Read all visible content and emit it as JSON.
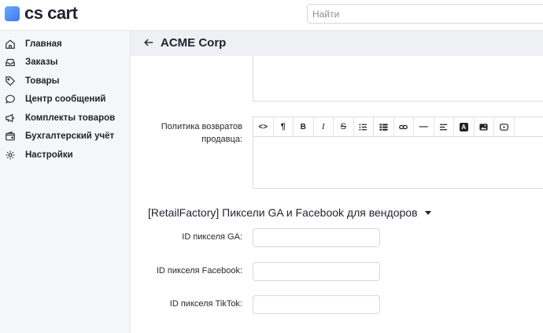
{
  "app": {
    "logo_text": "cs cart"
  },
  "search": {
    "placeholder": "Найти"
  },
  "sidebar": {
    "items": [
      {
        "label": "Главная",
        "icon": "home-icon"
      },
      {
        "label": "Заказы",
        "icon": "inbox-icon"
      },
      {
        "label": "Товары",
        "icon": "tag-icon"
      },
      {
        "label": "Центр сообщений",
        "icon": "message-icon"
      },
      {
        "label": "Комплекты товаров",
        "icon": "megaphone-icon"
      },
      {
        "label": "Бухгалтерский учёт",
        "icon": "wallet-icon"
      },
      {
        "label": "Настройки",
        "icon": "gear-icon"
      }
    ]
  },
  "header": {
    "title": "ACME Corp",
    "back_icon": "arrow-left-icon"
  },
  "form": {
    "return_policy_label": "Политика возвратов продавца:",
    "toolbar_buttons": [
      {
        "name": "code-view",
        "glyph": "<>"
      },
      {
        "name": "paragraph",
        "glyph": "¶"
      },
      {
        "name": "bold",
        "glyph": "B"
      },
      {
        "name": "italic",
        "glyph": "I"
      },
      {
        "name": "strikethrough",
        "glyph": "S"
      },
      {
        "name": "unordered-list",
        "glyph": ""
      },
      {
        "name": "ordered-list",
        "glyph": ""
      },
      {
        "name": "link",
        "glyph": ""
      },
      {
        "name": "horizontal-rule",
        "glyph": "—"
      },
      {
        "name": "align",
        "glyph": ""
      },
      {
        "name": "font-color",
        "glyph": "A"
      },
      {
        "name": "image",
        "glyph": ""
      },
      {
        "name": "video",
        "glyph": ""
      }
    ],
    "section_title": "[RetailFactory] Пиксели GA и Facebook для вендоров",
    "fields": [
      {
        "label": "ID пикселя GA:",
        "value": ""
      },
      {
        "label": "ID пикселя Facebook:",
        "value": ""
      },
      {
        "label": "ID пикселя TikTok:",
        "value": ""
      }
    ]
  },
  "colors": {
    "accent": "#3a78f2",
    "sidebar_bg": "#f5f6f7",
    "header_bg": "#eef0f3"
  }
}
